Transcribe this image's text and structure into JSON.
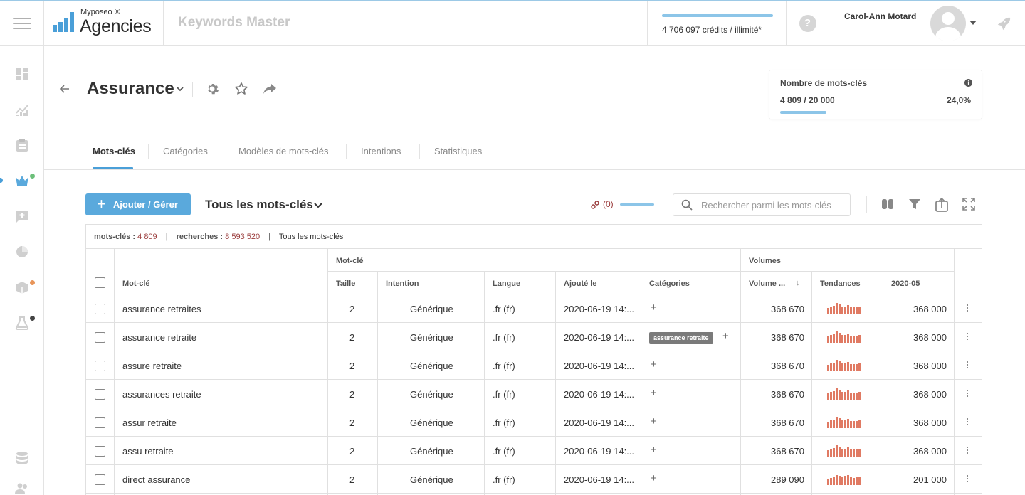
{
  "topbar": {
    "logo_small": "Myposeo ®",
    "logo_big": "Agencies",
    "app_name": "Keywords Master",
    "credits_text": "4 706 097 crédits / illimité*",
    "help_label": "?",
    "user_name": "Carol-Ann Motard"
  },
  "project": {
    "title": "Assurance"
  },
  "kw_card": {
    "title": "Nombre de mots-clés",
    "info": "i",
    "count": "4 809 / 20 000",
    "percent": "24,0%",
    "progress": 0.24
  },
  "tabs": [
    {
      "label": "Mots-clés",
      "active": true
    },
    {
      "label": "Catégories",
      "active": false
    },
    {
      "label": "Modèles de mots-clés",
      "active": false
    },
    {
      "label": "Intentions",
      "active": false
    },
    {
      "label": "Statistiques",
      "active": false
    }
  ],
  "toolbar": {
    "add_label": "Ajouter / Gérer",
    "add_plus": "+",
    "filter_label": "Tous les mots-clés",
    "links_label": "(0)",
    "search_placeholder": "Rechercher parmi les mots-clés"
  },
  "summary": {
    "kw_label": "mots-clés :",
    "kw_value": "4 809",
    "search_label": "recherches :",
    "search_value": "8 593 520",
    "pipe": "|",
    "filter": "Tous les mots-clés"
  },
  "table": {
    "group_motcle": "Mot-clé",
    "group_volumes": "Volumes",
    "headers": {
      "keyword": "Mot-clé",
      "size": "Taille",
      "intent": "Intention",
      "lang": "Langue",
      "added": "Ajouté le",
      "categories": "Catégories",
      "volume": "Volume ...",
      "sort": "↓",
      "trends": "Tendances",
      "month": "2020-05"
    },
    "plus": "+",
    "rows": [
      {
        "keyword": "assurance retraites",
        "size": "2",
        "intent": "Générique",
        "lang": ".fr (fr)",
        "added": "2020-06-19 14:...",
        "category": "",
        "volume": "368 670",
        "month": "368 000",
        "trend": [
          0.55,
          0.7,
          0.75,
          1,
          0.85,
          0.7,
          0.7,
          0.8,
          0.65,
          0.6,
          0.65,
          0.7
        ]
      },
      {
        "keyword": "assurance retraite",
        "size": "2",
        "intent": "Générique",
        "lang": ".fr (fr)",
        "added": "2020-06-19 14:...",
        "category": "assurance retraite",
        "volume": "368 670",
        "month": "368 000",
        "trend": [
          0.55,
          0.7,
          0.75,
          1,
          0.85,
          0.7,
          0.7,
          0.8,
          0.65,
          0.6,
          0.65,
          0.7
        ]
      },
      {
        "keyword": "assure retraite",
        "size": "2",
        "intent": "Générique",
        "lang": ".fr (fr)",
        "added": "2020-06-19 14:...",
        "category": "",
        "volume": "368 670",
        "month": "368 000",
        "trend": [
          0.55,
          0.7,
          0.75,
          1,
          0.85,
          0.7,
          0.7,
          0.8,
          0.65,
          0.6,
          0.65,
          0.7
        ]
      },
      {
        "keyword": "assurances retraite",
        "size": "2",
        "intent": "Générique",
        "lang": ".fr (fr)",
        "added": "2020-06-19 14:...",
        "category": "",
        "volume": "368 670",
        "month": "368 000",
        "trend": [
          0.55,
          0.7,
          0.75,
          1,
          0.85,
          0.7,
          0.7,
          0.8,
          0.65,
          0.6,
          0.65,
          0.7
        ]
      },
      {
        "keyword": "assur retraite",
        "size": "2",
        "intent": "Générique",
        "lang": ".fr (fr)",
        "added": "2020-06-19 14:...",
        "category": "",
        "volume": "368 670",
        "month": "368 000",
        "trend": [
          0.55,
          0.7,
          0.75,
          1,
          0.85,
          0.7,
          0.7,
          0.8,
          0.65,
          0.6,
          0.65,
          0.7
        ]
      },
      {
        "keyword": "assu retraite",
        "size": "2",
        "intent": "Générique",
        "lang": ".fr (fr)",
        "added": "2020-06-19 14:...",
        "category": "",
        "volume": "368 670",
        "month": "368 000",
        "trend": [
          0.55,
          0.7,
          0.75,
          1,
          0.85,
          0.7,
          0.7,
          0.8,
          0.65,
          0.6,
          0.65,
          0.7
        ]
      },
      {
        "keyword": "direct assurance",
        "size": "2",
        "intent": "Générique",
        "lang": ".fr (fr)",
        "added": "2020-06-19 14:...",
        "category": "",
        "volume": "289 090",
        "month": "201 000",
        "trend": [
          0.5,
          0.6,
          0.7,
          0.9,
          0.8,
          0.75,
          0.8,
          0.85,
          0.7,
          0.65,
          0.7,
          0.75
        ]
      }
    ]
  },
  "colors": {
    "accent": "#5aa9dc",
    "spark": "#e07a63",
    "badge": "#7a7a7a",
    "link_red": "#9a3b3b"
  },
  "icons": {
    "menu": "hamburger-icon",
    "logo": "bar-chart-logo-icon",
    "rocket": "rocket-icon",
    "settings": "gear-icon",
    "favorite": "star-icon",
    "share": "share-arrow-icon"
  }
}
